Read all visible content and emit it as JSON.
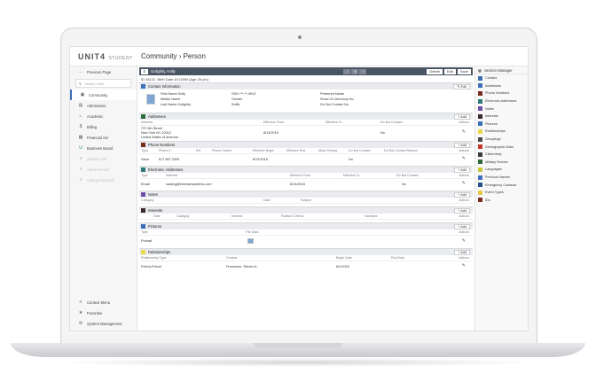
{
  "app": {
    "logo": "UNIT4",
    "logo_sub": "STUDENT",
    "breadcrumb_root": "Community",
    "breadcrumb_sep": "›",
    "breadcrumb_page": "Person"
  },
  "nav": {
    "previous_page": "Previous Page",
    "search_placeholder": "Search Here",
    "items": [
      {
        "label": "Community",
        "icon": "community-icon"
      },
      {
        "label": "Admissions",
        "icon": "admissions-icon"
      },
      {
        "label": "Academic",
        "icon": "academic-icon"
      },
      {
        "label": "Billing",
        "icon": "billing-icon"
      },
      {
        "label": "Financial Aid",
        "icon": "financial-aid-icon"
      },
      {
        "label": "Business Board",
        "icon": "business-board-icon"
      },
      {
        "label": "Student Life",
        "icon": "student-life-icon"
      },
      {
        "label": "Advancement",
        "icon": "advancement-icon"
      },
      {
        "label": "College Records",
        "icon": "college-records-icon"
      }
    ],
    "bottom": [
      {
        "label": "Context Menu",
        "icon": "context-menu-icon"
      },
      {
        "label": "Favorites",
        "icon": "star-icon"
      },
      {
        "label": "System Management",
        "icon": "gear-icon"
      }
    ]
  },
  "record": {
    "name": "Golightly, Holly",
    "delete_label": "Delete",
    "edit_label": "Edit",
    "save_label": "Save",
    "id_line": "ID 34131",
    "birth_line": "Birth Date 4/1/1989 (Age 26 yrs)"
  },
  "contact": {
    "title": "Contact Information",
    "edit": "Edit",
    "first_name": "First Name Holly",
    "middle_name": "Middle Name",
    "last_name": "Last Name Golightly",
    "ssn": "SSN ***-**-4913",
    "gender": "Gender",
    "suffix": "Suffix",
    "preferred_name": "Preferred Name",
    "show_on_directory": "Show On Directory  No",
    "do_not_contact": "Do Not Contact  No"
  },
  "addresses": {
    "title": "Addresses",
    "add": "Add",
    "columns": [
      "Address",
      "Effective From",
      "Effective To",
      "Do Not Contact",
      "Actions"
    ],
    "rows": [
      {
        "address": [
          "737 6th Street",
          "New York NY 10012",
          "United States of America"
        ],
        "effective_from": "8/13/2015",
        "effective_to": "",
        "do_not_contact": "No"
      }
    ]
  },
  "phones": {
    "title": "Phone Numbers",
    "add": "Add",
    "columns": [
      "Type",
      "Phone #",
      "Ext",
      "Phone Carrier",
      "Effective Begin",
      "Effective End",
      "Allow Texting",
      "Do Not Contact",
      "Do Not Contact Reason",
      "Actions"
    ],
    "rows": [
      {
        "type": "Voice",
        "phone": "517 867 2309",
        "effective_begin": "8/13/2015",
        "do_not_contact": "No"
      }
    ]
  },
  "electronic": {
    "title": "Electronic Addresses",
    "add": "Add",
    "columns": [
      "Type",
      "Address",
      "Effective From",
      "Effective To",
      "Do Not Contact",
      "Actions"
    ],
    "rows": [
      {
        "type": "Email",
        "address": "sarahg@freemansystems.com",
        "effective_from": "8/13/2015",
        "do_not_contact": "No"
      }
    ]
  },
  "notes": {
    "title": "Notes",
    "add": "Add",
    "columns": [
      "Category",
      "Date",
      "Subject",
      "Actions"
    ]
  },
  "interests": {
    "title": "Interests",
    "add": "Add",
    "columns": [
      "Date",
      "Category",
      "Interest",
      "Ranked Criteria",
      "Narrative",
      "Actions"
    ]
  },
  "pictures": {
    "title": "Pictures",
    "add": "Add",
    "columns": [
      "Type",
      "File Data",
      "Actions"
    ],
    "rows": [
      {
        "type": "Portrait"
      }
    ]
  },
  "relationships": {
    "title": "Relationships",
    "add": "Add",
    "columns": [
      "Relationship Type",
      "Contact",
      "Begin Date",
      "End Date",
      "Actions"
    ],
    "rows": [
      {
        "type": "Friend-Friend",
        "contact": "Freestone, Steven A",
        "begin": "8/1/2015"
      }
    ]
  },
  "section_manager": {
    "title": "Section Manager",
    "items": [
      {
        "label": "Contact",
        "color": "#3b6fb6"
      },
      {
        "label": "Addresses",
        "color": "#3b6fb6"
      },
      {
        "label": "Phone Numbers",
        "color": "#7a2c1e"
      },
      {
        "label": "Electronic Addresses",
        "color": "#2b7a78"
      },
      {
        "label": "Notes",
        "color": "#6b4fa3"
      },
      {
        "label": "Interests",
        "color": "#3a2a2a"
      },
      {
        "label": "Pictures",
        "color": "#3b6fb6"
      },
      {
        "label": "Relationships",
        "color": "#e8d84a"
      },
      {
        "label": "Groupings",
        "color": "#4a4a4a"
      },
      {
        "label": "Demographic Data",
        "color": "#c0392b"
      },
      {
        "label": "Citizenship",
        "color": "#3b3b3b"
      },
      {
        "label": "Military Service",
        "color": "#2e6b3a"
      },
      {
        "label": "Languages",
        "color": "#c8c83a"
      },
      {
        "label": "Previous Names",
        "color": "#3b6fb6"
      },
      {
        "label": "Emergency Contacts",
        "color": "#2a4f8a"
      },
      {
        "label": "Event Types",
        "color": "#e8c84a"
      },
      {
        "label": "IDs",
        "color": "#7a2c1e"
      }
    ]
  },
  "colors": {
    "record_bar": "#4a5563",
    "section_head": "#e9ebee"
  }
}
